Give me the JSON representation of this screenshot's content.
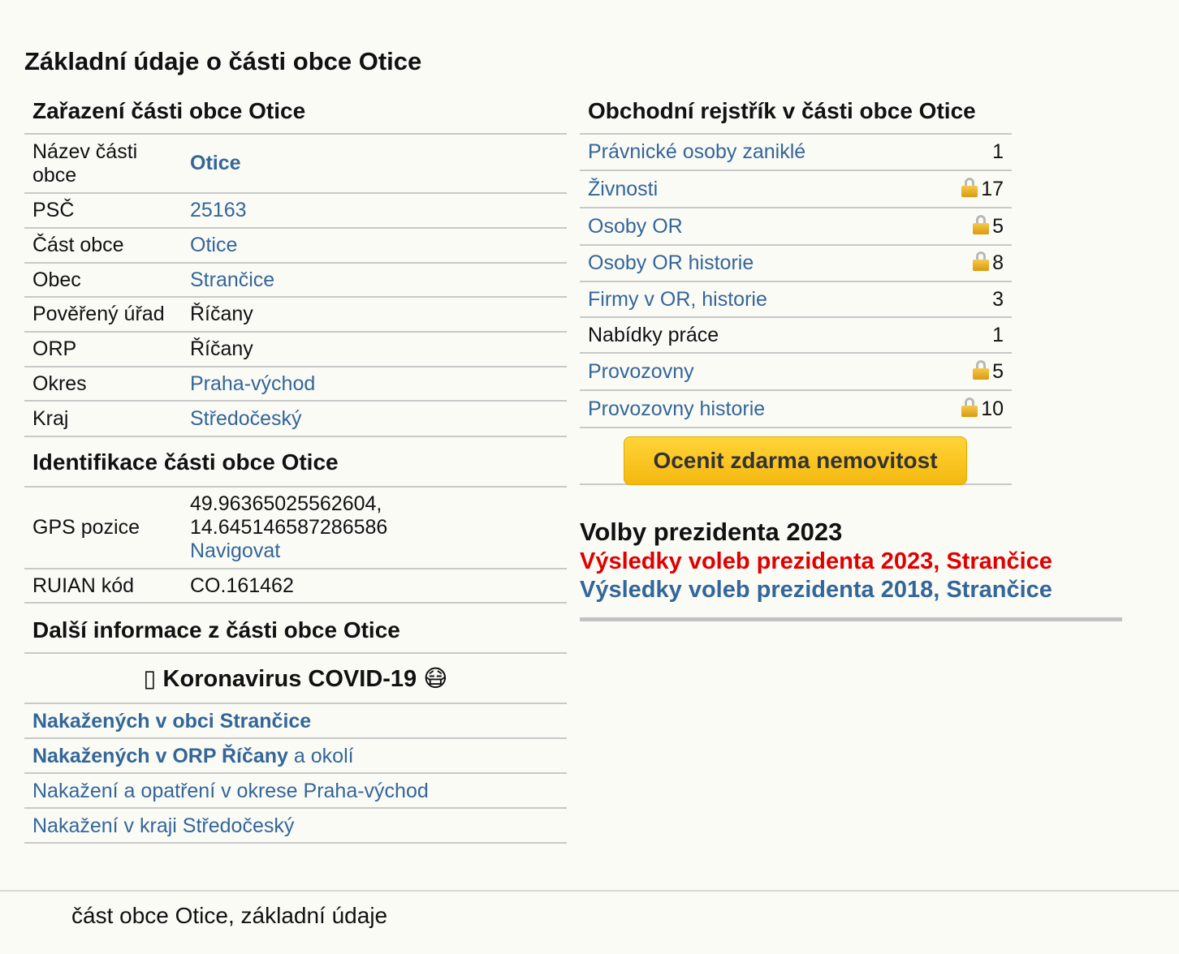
{
  "page_title": "Základní údaje o části obce Otice",
  "zarazeni": {
    "heading": "Zařazení části obce Otice",
    "rows": [
      {
        "key": "Název části obce",
        "value": "Otice"
      },
      {
        "key": "PSČ",
        "value": "25163"
      },
      {
        "key": "Část obce",
        "value": "Otice"
      },
      {
        "key": "Obec",
        "value": "Strančice"
      },
      {
        "key": "Pověřený úřad",
        "value": "Říčany"
      },
      {
        "key": "ORP",
        "value": "Říčany"
      },
      {
        "key": "Okres",
        "value": "Praha-východ"
      },
      {
        "key": "Kraj",
        "value": "Středočeský"
      }
    ]
  },
  "identifikace": {
    "heading": "Identifikace části obce Otice",
    "gps_key": "GPS pozice",
    "gps_lat": "49.96365025562604,",
    "gps_lon": "14.645146587286586",
    "gps_nav": "Navigovat",
    "ruian_key": "RUIAN kód",
    "ruian_value": "CO.161462"
  },
  "dalsi": {
    "heading": "Další informace z části obce Otice",
    "covid_heading": "Koronavirus COVID-19",
    "covid_prefix_glyph": "▯",
    "covid_suffix_glyph": "😷",
    "link1": "Nakažených v obci Strančice",
    "link2_bold": "Nakažených v ORP Říčany",
    "link2_rest": " a okolí",
    "link3": "Nakažení a opatření v okrese Praha-východ",
    "link4": "Nakažení v kraji Středočeský"
  },
  "rejstrik": {
    "heading": "Obchodní rejstřík v části obce Otice",
    "rows": [
      {
        "label": "Právnické osoby zaniklé",
        "count": "1"
      },
      {
        "label": "Živnosti",
        "count": "17"
      },
      {
        "label": "Osoby OR",
        "count": "5"
      },
      {
        "label": "Osoby OR historie",
        "count": "8"
      },
      {
        "label": "Firmy v OR, historie",
        "count": "3"
      },
      {
        "label": "Nabídky práce",
        "count": "1"
      },
      {
        "label": "Provozovny",
        "count": "5"
      },
      {
        "label": "Provozovny historie",
        "count": "10"
      }
    ],
    "button": "Ocenit zdarma nemovitost"
  },
  "volby": {
    "heading": "Volby prezidenta 2023",
    "link_2023": "Výsledky voleb prezidenta 2023, Strančice",
    "link_2018": "Výsledky voleb prezidenta 2018, Strančice"
  },
  "footer": "část obce Otice, základní údaje"
}
